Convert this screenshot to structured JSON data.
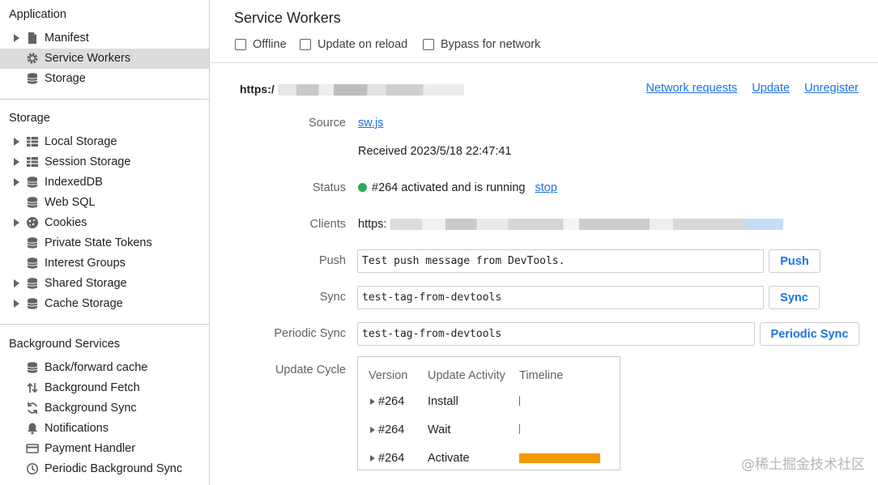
{
  "sidebar": {
    "application_title": "Application",
    "application_items": [
      {
        "label": "Manifest",
        "icon": "document-icon",
        "expandable": true
      },
      {
        "label": "Service Workers",
        "icon": "gear-icon",
        "expandable": false,
        "selected": true
      },
      {
        "label": "Storage",
        "icon": "database-icon",
        "expandable": false
      }
    ],
    "storage_title": "Storage",
    "storage_items": [
      {
        "label": "Local Storage",
        "icon": "grid-icon",
        "expandable": true
      },
      {
        "label": "Session Storage",
        "icon": "grid-icon",
        "expandable": true
      },
      {
        "label": "IndexedDB",
        "icon": "database-icon",
        "expandable": true
      },
      {
        "label": "Web SQL",
        "icon": "database-icon",
        "expandable": false
      },
      {
        "label": "Cookies",
        "icon": "cookie-icon",
        "expandable": true
      },
      {
        "label": "Private State Tokens",
        "icon": "database-icon",
        "expandable": false
      },
      {
        "label": "Interest Groups",
        "icon": "database-icon",
        "expandable": false
      },
      {
        "label": "Shared Storage",
        "icon": "database-icon",
        "expandable": true
      },
      {
        "label": "Cache Storage",
        "icon": "database-icon",
        "expandable": true
      }
    ],
    "background_title": "Background Services",
    "background_items": [
      {
        "label": "Back/forward cache",
        "icon": "database-icon"
      },
      {
        "label": "Background Fetch",
        "icon": "up-down-arrows-icon"
      },
      {
        "label": "Background Sync",
        "icon": "sync-icon"
      },
      {
        "label": "Notifications",
        "icon": "bell-icon"
      },
      {
        "label": "Payment Handler",
        "icon": "card-icon"
      },
      {
        "label": "Periodic Background Sync",
        "icon": "clock-icon"
      }
    ]
  },
  "main": {
    "title": "Service Workers",
    "options": [
      "Offline",
      "Update on reload",
      "Bypass for network"
    ],
    "origin_prefix": "https:/",
    "links": [
      "Network requests",
      "Update",
      "Unregister"
    ],
    "source_label": "Source",
    "source_link": "sw.js",
    "received": "Received 2023/5/18 22:47:41",
    "status_label": "Status",
    "status_text": "#264 activated and is running",
    "status_action": "stop",
    "status_color": "#34a853",
    "clients_label": "Clients",
    "clients_prefix": "https:",
    "push_label": "Push",
    "push_value": "Test push message from DevTools.",
    "push_button": "Push",
    "sync_label": "Sync",
    "sync_value": "test-tag-from-devtools",
    "sync_button": "Sync",
    "periodic_label": "Periodic Sync",
    "periodic_value": "test-tag-from-devtools",
    "periodic_button": "Periodic Sync",
    "cycle_label": "Update Cycle",
    "cycle_headers": [
      "Version",
      "Update Activity",
      "Timeline"
    ],
    "cycle_rows": [
      {
        "version": "#264",
        "activity": "Install",
        "color": "#1e8e3e"
      },
      {
        "version": "#264",
        "activity": "Wait",
        "color": "#a142f4"
      },
      {
        "version": "#264",
        "activity": "Activate",
        "color": "#f29900"
      }
    ]
  },
  "watermark": "@稀土掘金技术社区"
}
